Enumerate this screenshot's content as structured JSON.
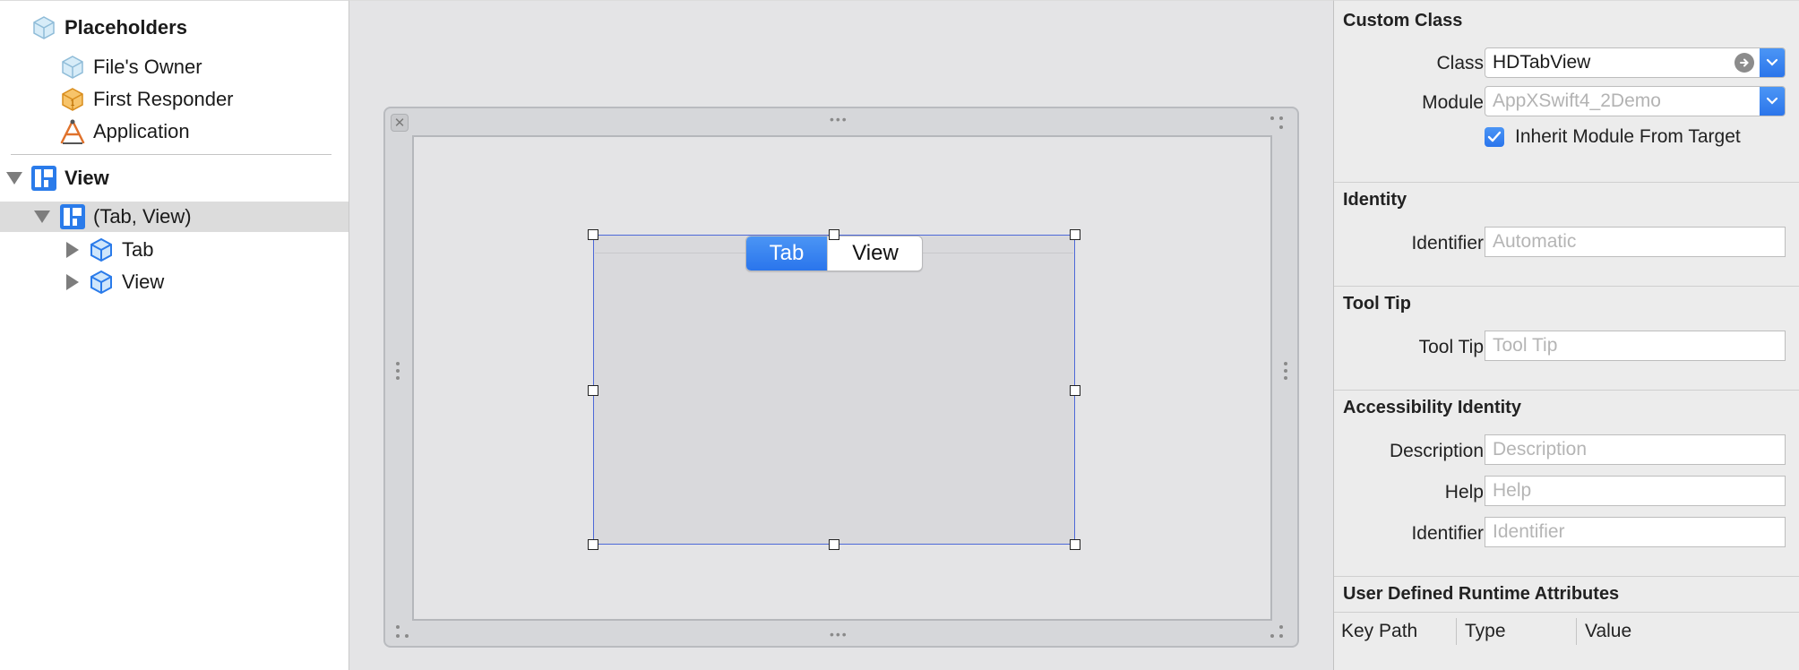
{
  "outline": {
    "placeholders_label": "Placeholders",
    "files_owner_label": "File's Owner",
    "first_responder_label": "First Responder",
    "application_label": "Application",
    "view_label": "View",
    "tab_view_label": "(Tab, View)",
    "tab_label": "Tab",
    "child_view_label": "View"
  },
  "canvas": {
    "segments": [
      "Tab",
      "View"
    ],
    "selected_segment": "Tab"
  },
  "inspector": {
    "custom_class": {
      "title": "Custom Class",
      "class_label": "Class",
      "class_value": "HDTabView",
      "module_label": "Module",
      "module_value": "AppXSwift4_2Demo",
      "inherit_label": "Inherit Module From Target",
      "inherit_checked": true
    },
    "identity": {
      "title": "Identity",
      "identifier_label": "Identifier",
      "identifier_placeholder": "Automatic"
    },
    "tool_tip": {
      "title": "Tool Tip",
      "label": "Tool Tip",
      "placeholder": "Tool Tip"
    },
    "accessibility": {
      "title": "Accessibility Identity",
      "description_label": "Description",
      "description_placeholder": "Description",
      "help_label": "Help",
      "help_placeholder": "Help",
      "identifier_label": "Identifier",
      "identifier_placeholder": "Identifier"
    },
    "runtime_attributes": {
      "title": "User Defined Runtime Attributes",
      "columns": [
        "Key Path",
        "Type",
        "Value"
      ]
    }
  },
  "colors": {
    "accent": "#2f7bf0",
    "selection_border": "#4d68d8",
    "canvas_bg": "#e4e4e6",
    "inspector_bg": "#ececec",
    "selected_row": "#dcdcdc"
  }
}
